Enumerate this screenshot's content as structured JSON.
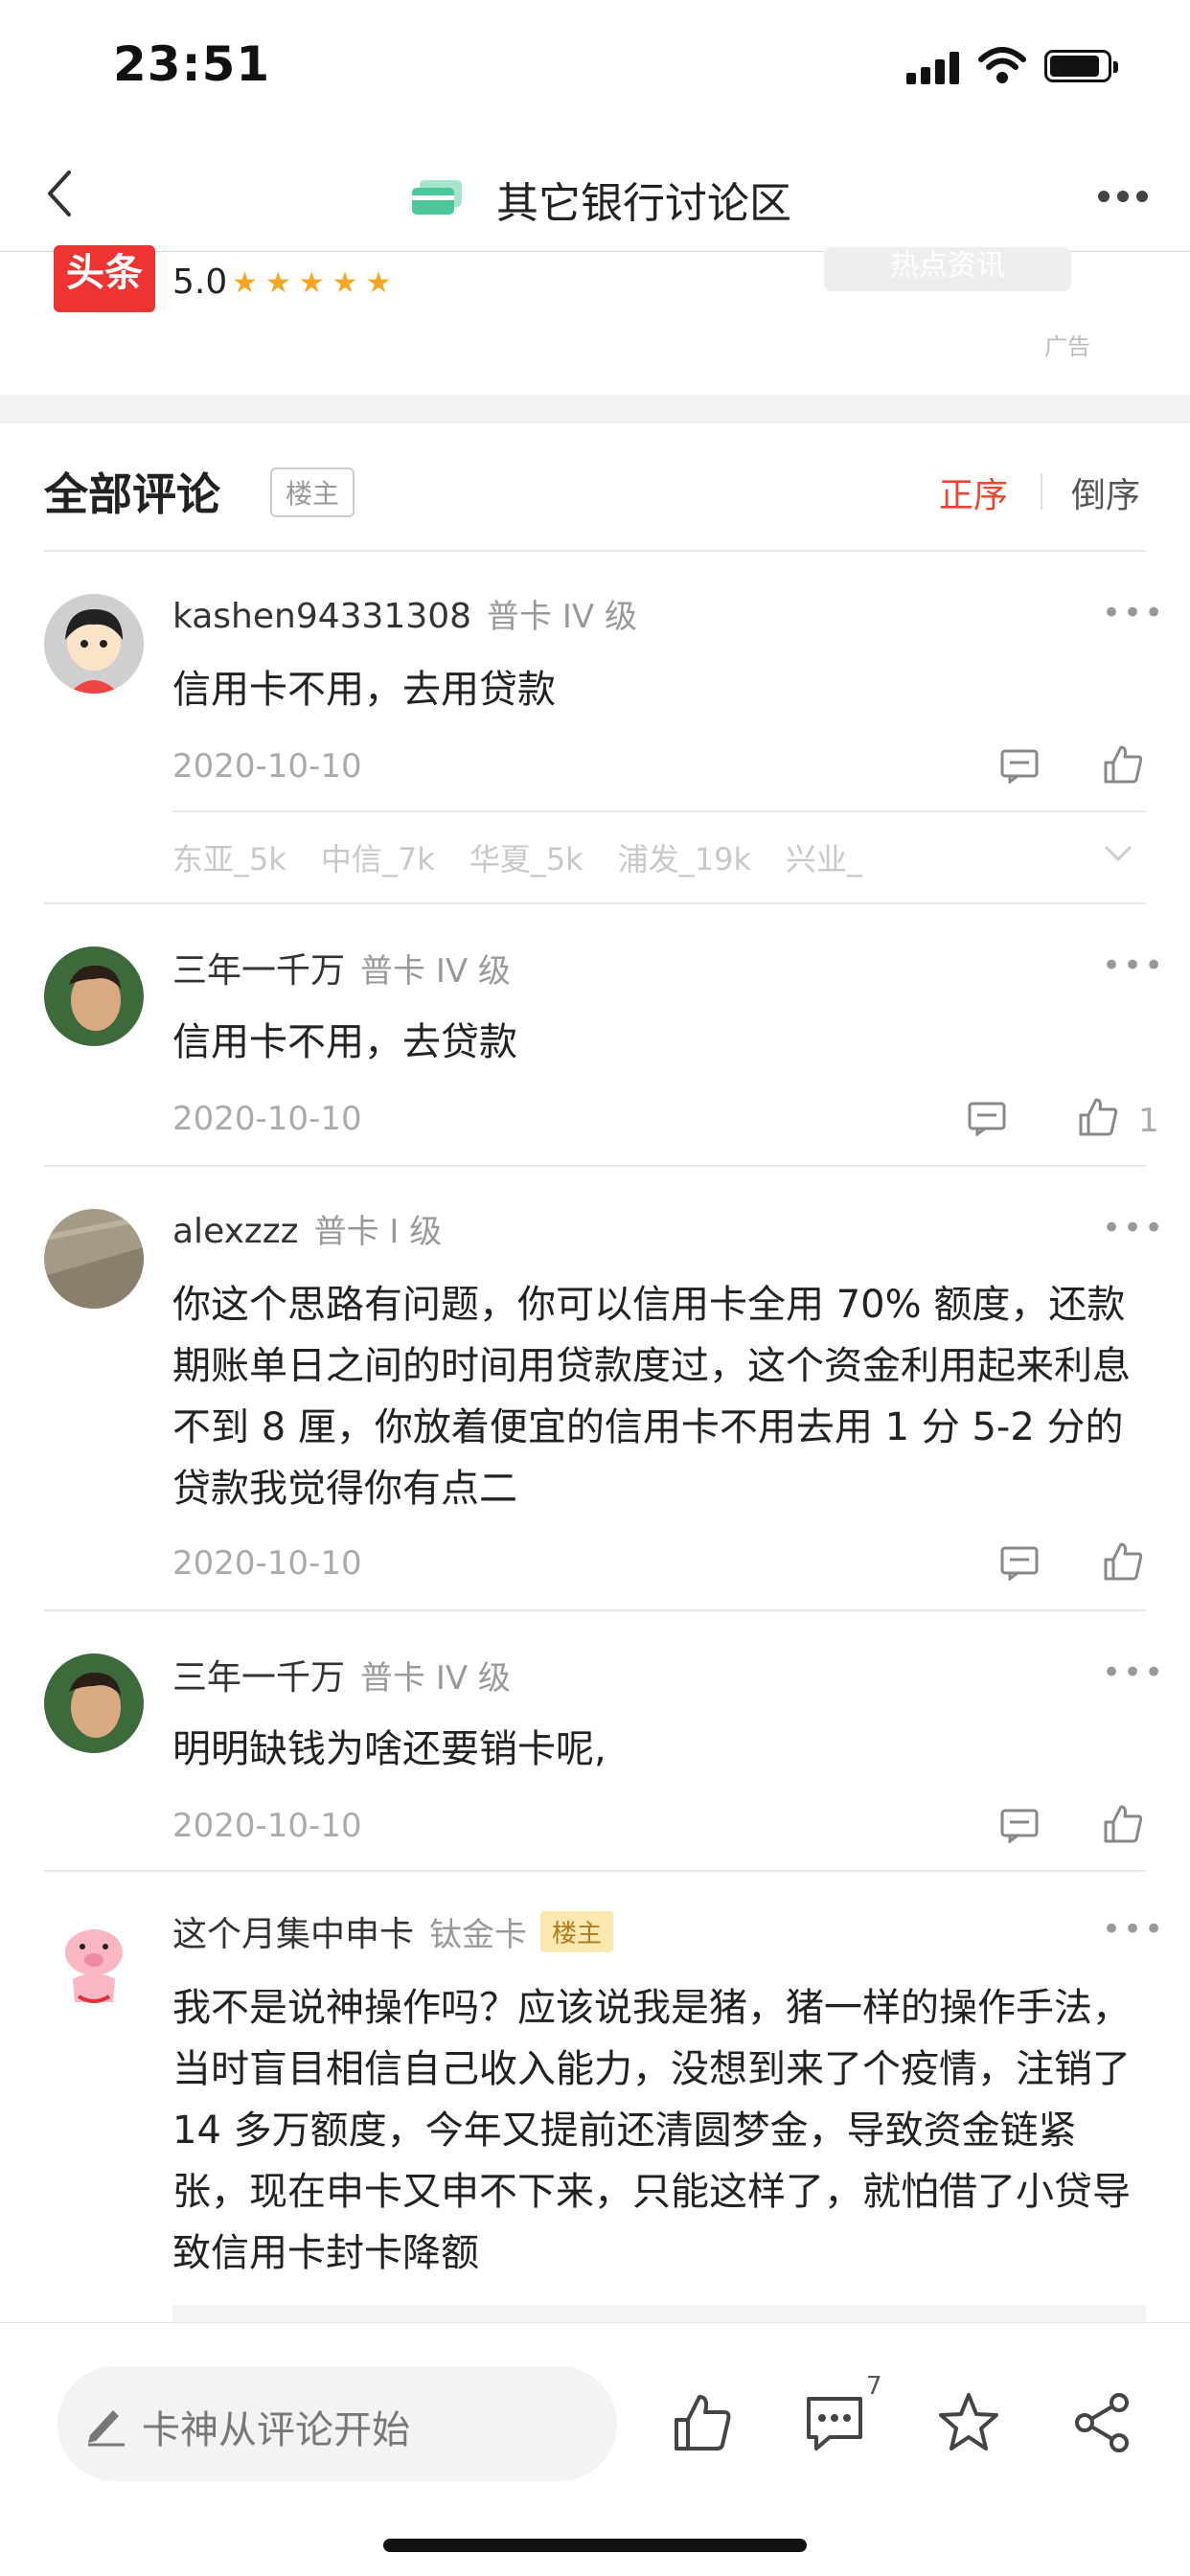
{
  "status": {
    "time": "23:51"
  },
  "nav": {
    "title": "其它银行讨论区"
  },
  "ad": {
    "logo_text": "头条",
    "rating": "5.0",
    "stars": "★★★★★",
    "button": "热点资讯",
    "tag": "广告"
  },
  "comments_header": {
    "title": "全部评论",
    "host_filter": "楼主",
    "sort_asc": "正序",
    "sort_desc": "倒序"
  },
  "comments": [
    {
      "user": "kashen94331308",
      "level": "普卡 IV 级",
      "text": "信用卡不用，去用贷款",
      "date": "2020-10-10",
      "likes": ""
    },
    {
      "user": "三年一千万",
      "level": "普卡 IV 级",
      "text": "信用卡不用，去贷款",
      "date": "2020-10-10",
      "likes": "1"
    },
    {
      "user": "alexzzz",
      "level": "普卡 I 级",
      "text": "你这个思路有问题，你可以信用卡全用 70% 额度，还款期账单日之间的时间用贷款度过，这个资金利用起来利息不到 8 厘，你放着便宜的信用卡不用去用 1 分 5-2 分的贷款我觉得你有点二",
      "date": "2020-10-10",
      "likes": ""
    },
    {
      "user": "三年一千万",
      "level": "普卡 IV 级",
      "text": "明明缺钱为啥还要销卡呢,",
      "date": "2020-10-10",
      "likes": ""
    },
    {
      "user": "这个月集中申卡",
      "level": "钛金卡",
      "badge": "楼主",
      "text": "我不是说神操作吗？应该说我是猪，猪一样的操作手法，当时盲目相信自己收入能力，没想到来了个疫情，注销了 14 多万额度，今年又提前还清圆梦金，导致资金链紧张，现在申卡又申不下来，只能这样了，就怕借了小贷导致信用卡封卡降额"
    }
  ],
  "tags": [
    "东亚_5k",
    "中信_7k",
    "华夏_5k",
    "浦发_19k",
    "兴业_"
  ],
  "bottom": {
    "placeholder": "卡神从评论开始",
    "comment_count": "7"
  },
  "colors": {
    "accent": "#e8462f",
    "forum_icon": "#4cc79a",
    "star": "#f5a623"
  }
}
